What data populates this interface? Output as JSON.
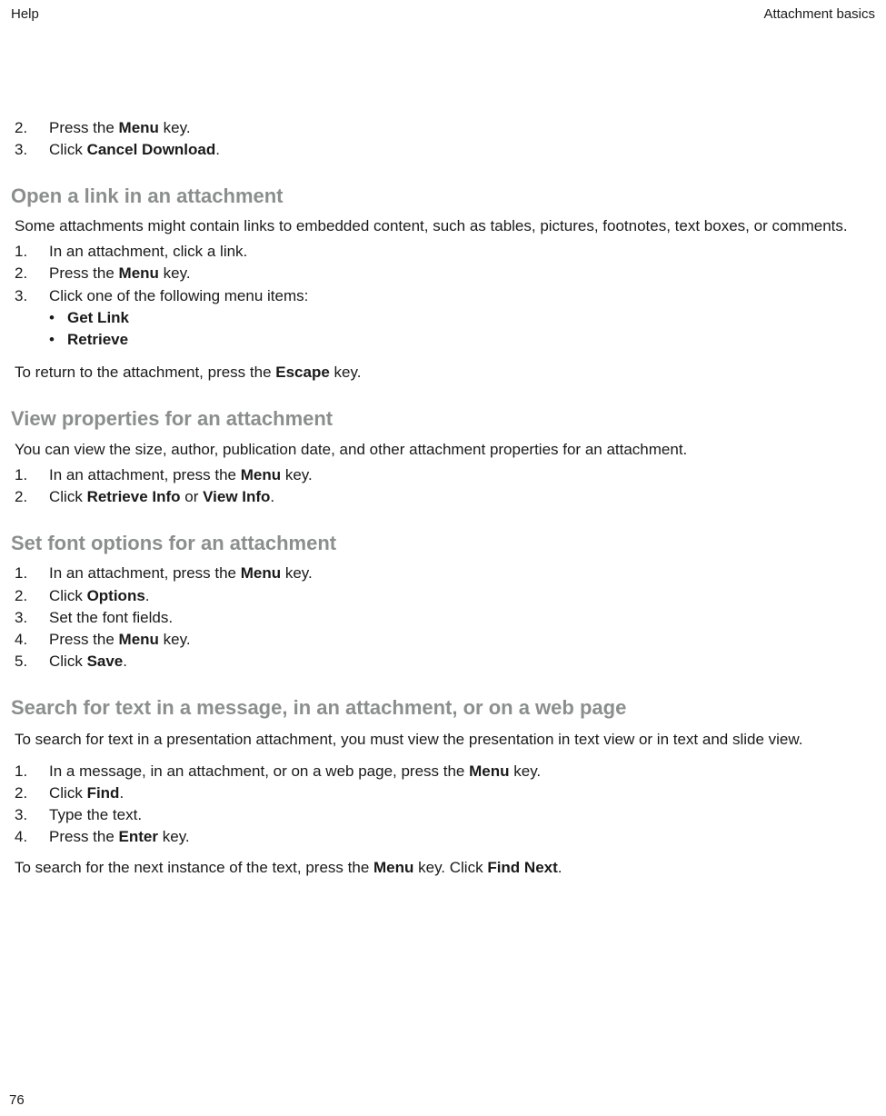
{
  "header": {
    "left": "Help",
    "right": "Attachment basics"
  },
  "page_number": "76",
  "intro_steps": [
    {
      "num": "2.",
      "parts": [
        {
          "t": "Press the "
        },
        {
          "t": "Menu",
          "b": true
        },
        {
          "t": " key."
        }
      ]
    },
    {
      "num": "3.",
      "parts": [
        {
          "t": "Click "
        },
        {
          "t": "Cancel Download",
          "b": true
        },
        {
          "t": "."
        }
      ]
    }
  ],
  "section1": {
    "title": "Open a link in an attachment",
    "lead": "Some attachments might contain links to embedded content, such as tables, pictures, footnotes, text boxes, or comments.",
    "steps": [
      {
        "num": "1.",
        "parts": [
          {
            "t": "In an attachment, click a link."
          }
        ]
      },
      {
        "num": "2.",
        "parts": [
          {
            "t": "Press the "
          },
          {
            "t": "Menu",
            "b": true
          },
          {
            "t": " key."
          }
        ]
      },
      {
        "num": "3.",
        "parts": [
          {
            "t": "Click one of the following menu items:"
          }
        ]
      }
    ],
    "bullets": [
      {
        "parts": [
          {
            "t": "Get Link",
            "b": true
          }
        ]
      },
      {
        "parts": [
          {
            "t": "Retrieve",
            "b": true
          }
        ]
      }
    ],
    "tail": {
      "parts": [
        {
          "t": "To return to the attachment, press the "
        },
        {
          "t": "Escape",
          "b": true
        },
        {
          "t": " key."
        }
      ]
    }
  },
  "section2": {
    "title": "View properties for an attachment",
    "lead": "You can view the size, author, publication date, and other attachment properties for an attachment.",
    "steps": [
      {
        "num": "1.",
        "parts": [
          {
            "t": "In an attachment, press the "
          },
          {
            "t": "Menu",
            "b": true
          },
          {
            "t": " key."
          }
        ]
      },
      {
        "num": "2.",
        "parts": [
          {
            "t": "Click "
          },
          {
            "t": "Retrieve Info",
            "b": true
          },
          {
            "t": " or "
          },
          {
            "t": "View Info",
            "b": true
          },
          {
            "t": "."
          }
        ]
      }
    ]
  },
  "section3": {
    "title": "Set font options for an attachment",
    "steps": [
      {
        "num": "1.",
        "parts": [
          {
            "t": "In an attachment, press the "
          },
          {
            "t": "Menu",
            "b": true
          },
          {
            "t": " key."
          }
        ]
      },
      {
        "num": "2.",
        "parts": [
          {
            "t": "Click "
          },
          {
            "t": "Options",
            "b": true
          },
          {
            "t": "."
          }
        ]
      },
      {
        "num": "3.",
        "parts": [
          {
            "t": "Set the font fields."
          }
        ]
      },
      {
        "num": "4.",
        "parts": [
          {
            "t": "Press the "
          },
          {
            "t": "Menu",
            "b": true
          },
          {
            "t": " key."
          }
        ]
      },
      {
        "num": "5.",
        "parts": [
          {
            "t": "Click "
          },
          {
            "t": "Save",
            "b": true
          },
          {
            "t": "."
          }
        ]
      }
    ]
  },
  "section4": {
    "title": "Search for text in a message, in an attachment, or on a web page",
    "lead": "To search for text in a presentation attachment, you must view the presentation in text view or in text and slide view.",
    "steps": [
      {
        "num": "1.",
        "parts": [
          {
            "t": "In a message, in an attachment, or on a web page, press the "
          },
          {
            "t": "Menu",
            "b": true
          },
          {
            "t": " key."
          }
        ]
      },
      {
        "num": "2.",
        "parts": [
          {
            "t": "Click "
          },
          {
            "t": "Find",
            "b": true
          },
          {
            "t": "."
          }
        ]
      },
      {
        "num": "3.",
        "parts": [
          {
            "t": "Type the text."
          }
        ]
      },
      {
        "num": "4.",
        "parts": [
          {
            "t": "Press the "
          },
          {
            "t": "Enter",
            "b": true
          },
          {
            "t": " key."
          }
        ]
      }
    ],
    "tail": {
      "parts": [
        {
          "t": "To search for the next instance of the text, press the "
        },
        {
          "t": "Menu",
          "b": true
        },
        {
          "t": " key. Click "
        },
        {
          "t": "Find Next",
          "b": true
        },
        {
          "t": "."
        }
      ]
    }
  }
}
